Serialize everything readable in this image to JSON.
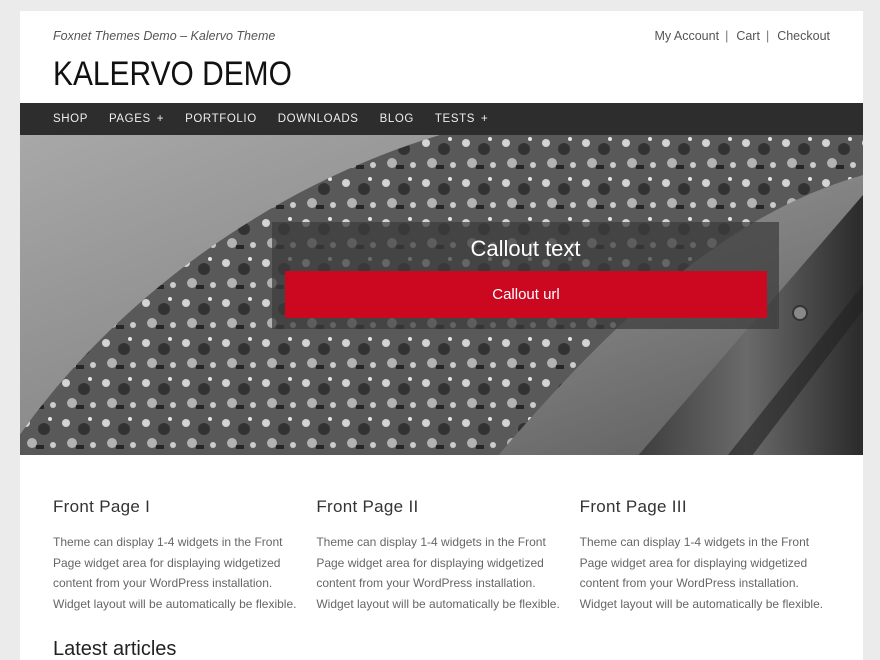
{
  "header": {
    "tagline": "Foxnet Themes Demo – Kalervo Theme",
    "site_title": "KALERVO DEMO",
    "account_links": [
      "My Account",
      "Cart",
      "Checkout"
    ],
    "separator": "|"
  },
  "main_nav": {
    "items": [
      {
        "label": "SHOP",
        "submenu": false
      },
      {
        "label": "PAGES",
        "submenu": true
      },
      {
        "label": "PORTFOLIO",
        "submenu": false
      },
      {
        "label": "DOWNLOADS",
        "submenu": false
      },
      {
        "label": "BLOG",
        "submenu": false
      },
      {
        "label": "TESTS",
        "submenu": true
      }
    ],
    "submenu_marker": "+"
  },
  "hero": {
    "callout_text": "Callout text",
    "callout_button": "Callout url",
    "button_color": "#cc0820"
  },
  "widgets": [
    {
      "title": "Front Page I",
      "body": "Theme can display 1-4 widgets in the Front Page widget area for displaying widgetized content from your WordPress installation. Widget layout will be automatically be flexible."
    },
    {
      "title": "Front Page II",
      "body": "Theme can display 1-4 widgets in the Front Page widget area for displaying widgetized content from your WordPress installation. Widget layout will be automatically be flexible."
    },
    {
      "title": "Front Page III",
      "body": "Theme can display 1-4 widgets in the Front Page widget area for displaying widgetized content from your WordPress installation. Widget layout will be automatically be flexible."
    }
  ],
  "latest_heading": "Latest articles"
}
